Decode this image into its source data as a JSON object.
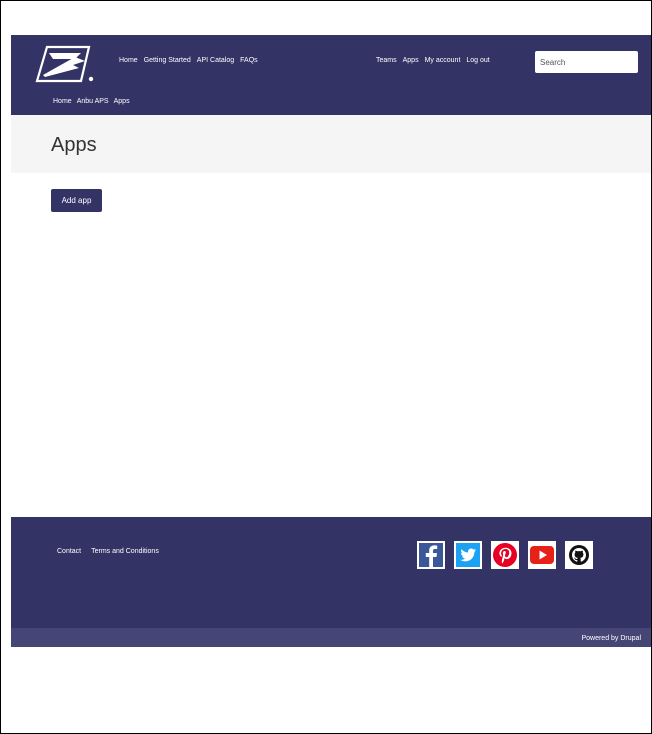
{
  "header": {
    "main_nav": [
      {
        "label": "Home"
      },
      {
        "label": "Getting Started"
      },
      {
        "label": "API Catalog"
      },
      {
        "label": "FAQs"
      }
    ],
    "user_nav": [
      {
        "label": "Teams"
      },
      {
        "label": "Apps"
      },
      {
        "label": "My account"
      },
      {
        "label": "Log out"
      }
    ],
    "search": {
      "placeholder": "Search"
    },
    "breadcrumb": [
      {
        "label": "Home"
      },
      {
        "label": "Anbu APS"
      },
      {
        "label": "Apps"
      }
    ],
    "colors": {
      "brand": "#333366",
      "text": "#ffffff"
    }
  },
  "page": {
    "title": "Apps",
    "add_button_label": "Add app"
  },
  "footer": {
    "links": [
      {
        "label": "Contact"
      },
      {
        "label": "Terms and Conditions"
      }
    ],
    "social_icons": [
      "facebook-icon",
      "twitter-icon",
      "pinterest-icon",
      "youtube-icon",
      "github-icon"
    ],
    "powered_by": "Powered by Drupal",
    "colors": {
      "footer": "#333366",
      "bottom_bar": "#454576"
    }
  }
}
